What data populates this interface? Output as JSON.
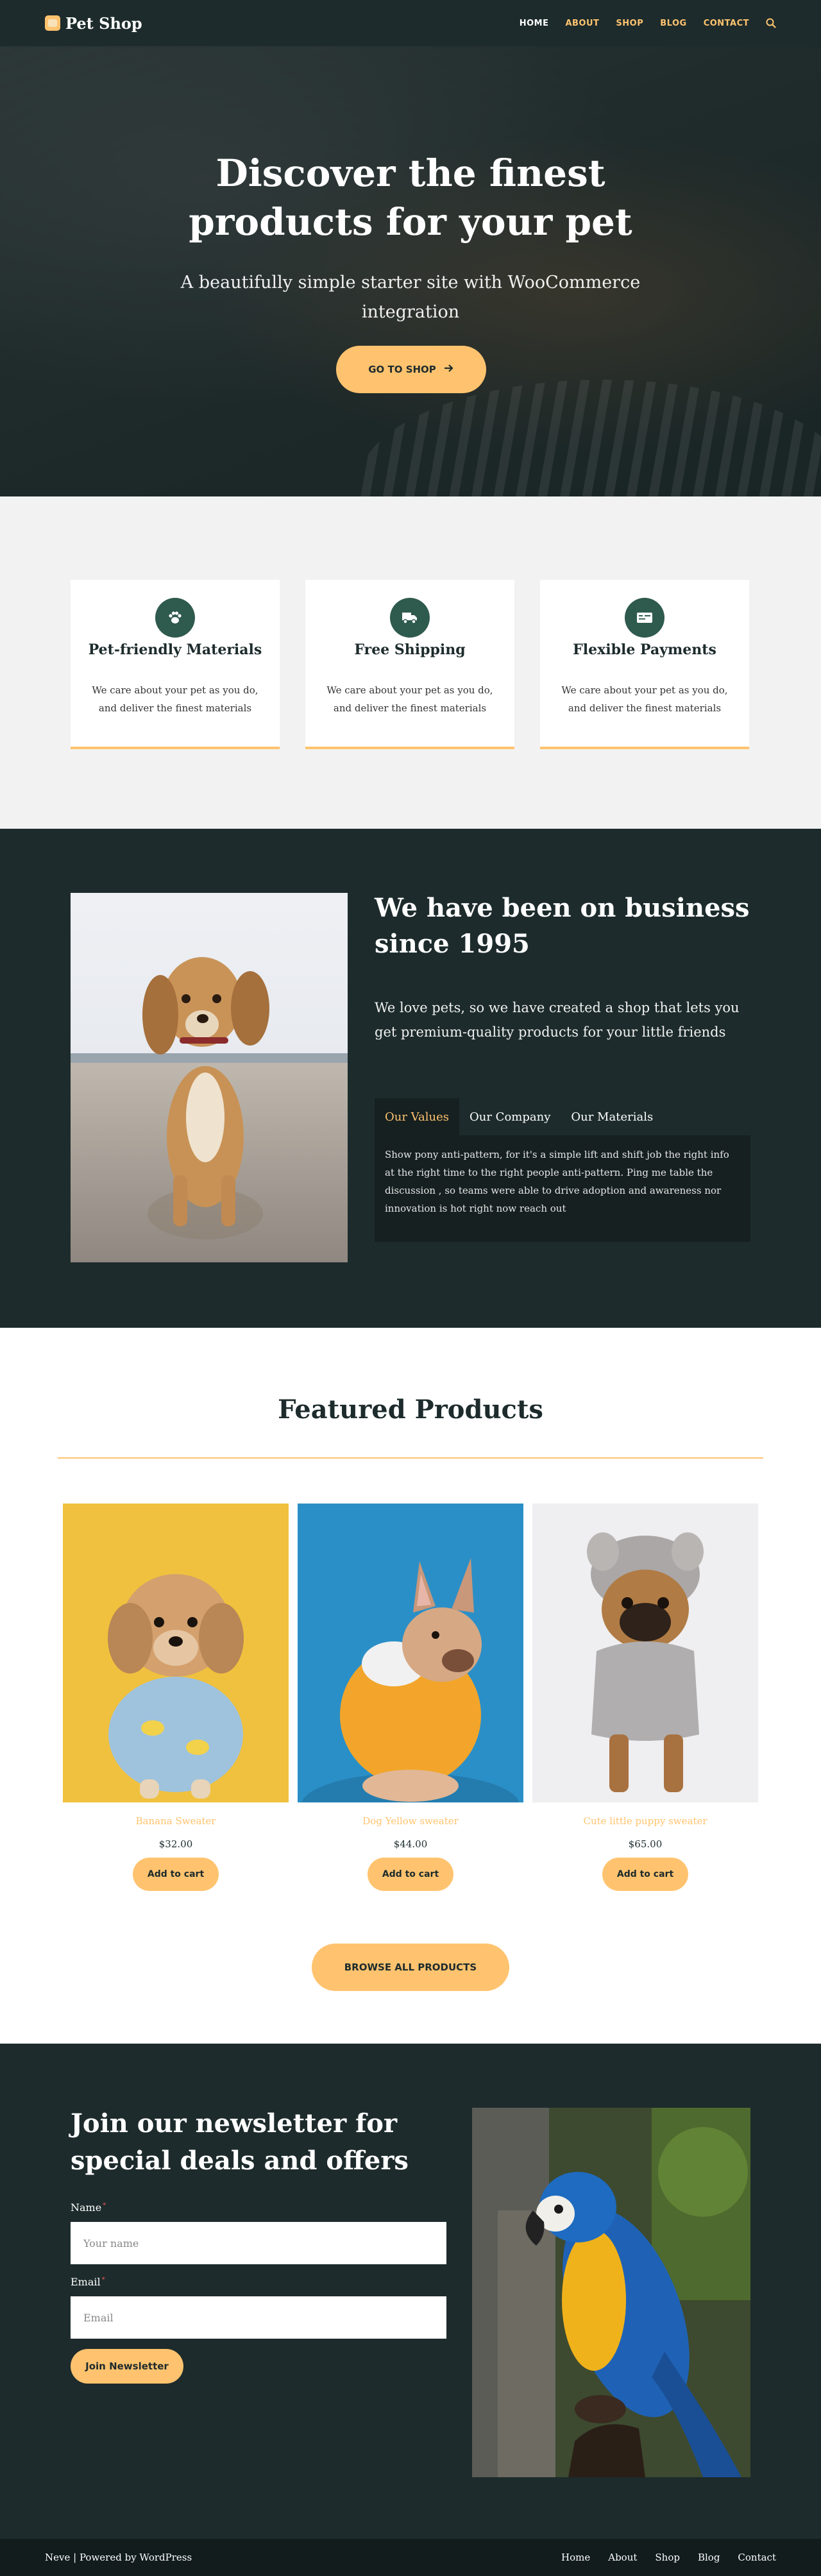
{
  "header": {
    "logo": "Pet Shop",
    "nav": [
      {
        "label": "HOME",
        "active": true
      },
      {
        "label": "ABOUT",
        "active": false
      },
      {
        "label": "SHOP",
        "active": false
      },
      {
        "label": "BLOG",
        "active": false
      },
      {
        "label": "CONTACT",
        "active": false
      }
    ],
    "accent": "#ffc36f"
  },
  "hero": {
    "title": "Discover the finest products for your pet",
    "subtitle": "A beautifully simple starter site with WooCommerce integration",
    "button": "GO TO SHOP"
  },
  "features": [
    {
      "icon": "paw-icon",
      "title": "Pet-friendly Materials",
      "text": "We care about your pet as you do, and deliver the finest materials"
    },
    {
      "icon": "truck-icon",
      "title": "Free Shipping",
      "text": "We care about your pet as you do, and deliver the finest materials"
    },
    {
      "icon": "payment-card-icon",
      "title": "Flexible Payments",
      "text": "We care about your pet as you do, and deliver the finest materials"
    }
  ],
  "about": {
    "title": "We have been on business since 1995",
    "text": "We love pets, so we have created a shop that lets you get premium-quality products for your little friends",
    "tabs": [
      "Our Values",
      "Our Company",
      "Our Materials"
    ],
    "active_tab": "Our Values",
    "tab_content": "Show pony anti-pattern, for it's a simple lift and shift job the right info at the right time to the right people anti-pattern. Ping me table the discussion , so teams were able to drive adoption and awareness nor innovation is hot right now reach out"
  },
  "products": {
    "title": "Featured Products",
    "items": [
      {
        "name": "Banana Sweater",
        "price": "$32.00",
        "button": "Add to cart"
      },
      {
        "name": "Dog Yellow sweater",
        "price": "$44.00",
        "button": "Add to cart"
      },
      {
        "name": "Cute little puppy sweater",
        "price": "$65.00",
        "button": "Add to cart"
      }
    ],
    "browse_button": "BROWSE ALL PRODUCTS"
  },
  "newsletter": {
    "title": "Join our newsletter for special deals and offers",
    "name_label": "Name",
    "name_placeholder": "Your name",
    "email_label": "Email",
    "email_placeholder": "Email",
    "button": "Join Newsletter"
  },
  "footer": {
    "credit": "Neve | Powered by WordPress",
    "links": [
      "Home",
      "About",
      "Shop",
      "Blog",
      "Contact"
    ]
  }
}
